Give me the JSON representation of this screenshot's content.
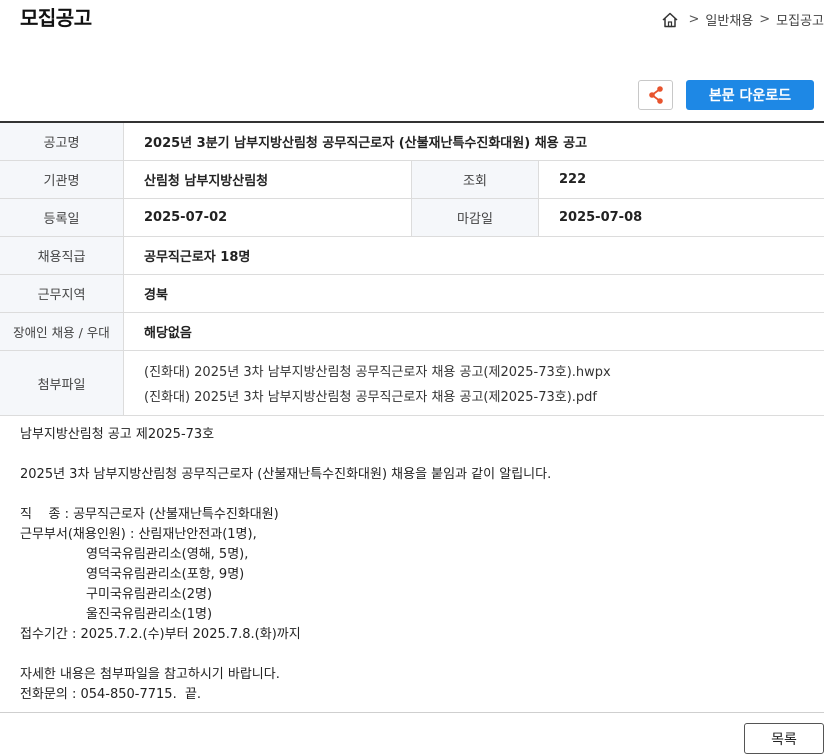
{
  "header": {
    "title": "모집공고",
    "breadcrumb": [
      "일반채용",
      "모집공고"
    ],
    "breadcrumb_sep": ">"
  },
  "actions": {
    "download_label": "본문 다운로드",
    "share_icon": "share-icon",
    "accent_color": "#1e88e5"
  },
  "info": {
    "title_label": "공고명",
    "title_value": "2025년 3분기 남부지방산림청 공무직근로자 (산불재난특수진화대원) 채용 공고",
    "org_label": "기관명",
    "org_value": "산림청 남부지방산림청",
    "views_label": "조회",
    "views_value": "222",
    "reg_label": "등록일",
    "reg_value": "2025-07-02",
    "deadline_label": "마감일",
    "deadline_value": "2025-07-08",
    "position_label": "채용직급",
    "position_value": "공무직근로자 18명",
    "region_label": "근무지역",
    "region_value": "경북",
    "disabled_label": "장애인 채용 / 우대",
    "disabled_value": "해당없음",
    "files_label": "첨부파일",
    "files": [
      "(진화대) 2025년 3차 남부지방산림청 공무직근로자 채용 공고(제2025-73호).hwpx",
      "(진화대) 2025년 3차 남부지방산림청 공무직근로자 채용 공고(제2025-73호).pdf"
    ]
  },
  "body": {
    "line1": "남부지방산림청 공고 제2025-73호",
    "line2": "2025년 3차 남부지방산림청 공무직근로자 (산불재난특수진화대원) 채용을 붙임과 같이 알립니다.",
    "line3": "직    종 : 공무직근로자 (산불재난특수진화대원)",
    "line4": "근무부서(채용인원) : 산림재난안전과(1명),",
    "line5": "영덕국유림관리소(영해, 5명),",
    "line6": "영덕국유림관리소(포항, 9명)",
    "line7": "구미국유림관리소(2명)",
    "line8": "울진국유림관리소(1명)",
    "line9": "접수기간 : 2025.7.2.(수)부터 2025.7.8.(화)까지",
    "line10": "자세한 내용은 첨부파일을 참고하시기 바랍니다.",
    "line11": "전화문의 : 054-850-7715.  끝."
  },
  "footer": {
    "list_label": "목록"
  }
}
